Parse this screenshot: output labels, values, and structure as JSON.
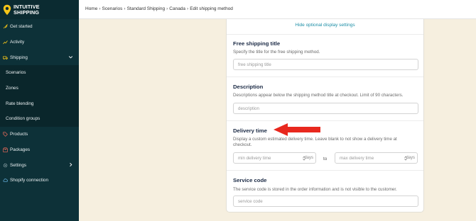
{
  "app": {
    "brand_line1": "INTUITIVE",
    "brand_line2": "SHIPPING"
  },
  "sidebar": {
    "items": [
      {
        "label": "Get started"
      },
      {
        "label": "Activity"
      },
      {
        "label": "Shipping"
      },
      {
        "label": "Scenarios"
      },
      {
        "label": "Zones"
      },
      {
        "label": "Rate blending"
      },
      {
        "label": "Condition groups"
      },
      {
        "label": "Products"
      },
      {
        "label": "Packages"
      },
      {
        "label": "Settings"
      },
      {
        "label": "Shopify connection"
      }
    ]
  },
  "breadcrumb": [
    "Home",
    "Scenarios",
    "Standard Shipping",
    "Canada",
    "Edit shipping method"
  ],
  "form": {
    "hide_optional": "Hide optional display settings",
    "free_title": {
      "title": "Free shipping title",
      "desc": "Specify the title for the free shipping method.",
      "placeholder": "free shipping title"
    },
    "description": {
      "title": "Description",
      "desc": "Descriptions appear below the shipping method title at checkout. Limit of 90 characters.",
      "placeholder": "description"
    },
    "delivery_time": {
      "title": "Delivery time",
      "desc": "Display a custom estimated delivery time. Leave blank to not show a delivery time at checkout.",
      "min_placeholder": "min delivery time",
      "max_placeholder": "max delivery time",
      "unit": "days",
      "to": "to"
    },
    "service_code": {
      "title": "Service code",
      "desc": "The service code is stored in the order information and is not visible to the customer.",
      "placeholder": "service code"
    }
  },
  "colors": {
    "sidebar": "#0d3138",
    "accent": "#f5c518",
    "link": "#1c8ea6",
    "arrow": "#e8281e"
  }
}
